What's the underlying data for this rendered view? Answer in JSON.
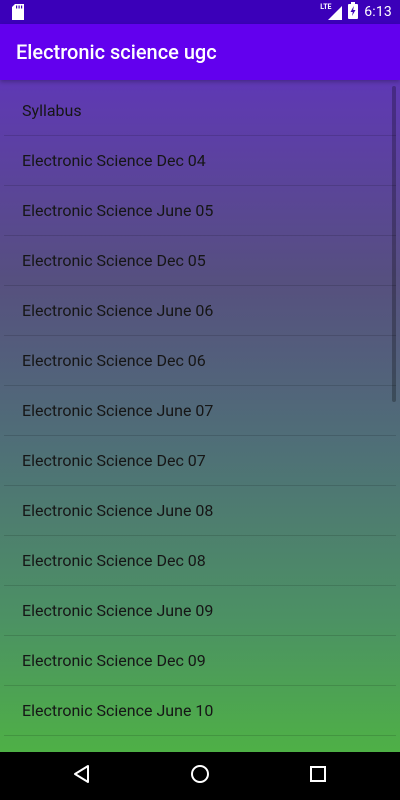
{
  "status_bar": {
    "time": "6:13",
    "network": "LTE",
    "icons": [
      "sd-card-icon",
      "lte-signal-icon",
      "battery-charging-icon"
    ]
  },
  "app_bar": {
    "title": "Electronic science ugc",
    "color": "#6200ee"
  },
  "list": {
    "items": [
      "Syllabus",
      "Electronic Science Dec 04",
      "Electronic Science June 05",
      "Electronic Science Dec 05",
      "Electronic Science June 06",
      "Electronic Science Dec 06",
      "Electronic Science June 07",
      "Electronic Science Dec 07",
      "Electronic Science June 08",
      "Electronic Science Dec 08",
      "Electronic Science June 09",
      "Electronic Science Dec 09",
      "Electronic Science June 10"
    ],
    "background_gradient": [
      "#5f38b5",
      "#4eb046"
    ]
  },
  "nav_bar": {
    "icons": [
      "back-triangle-icon",
      "home-circle-icon",
      "recents-square-icon"
    ]
  }
}
